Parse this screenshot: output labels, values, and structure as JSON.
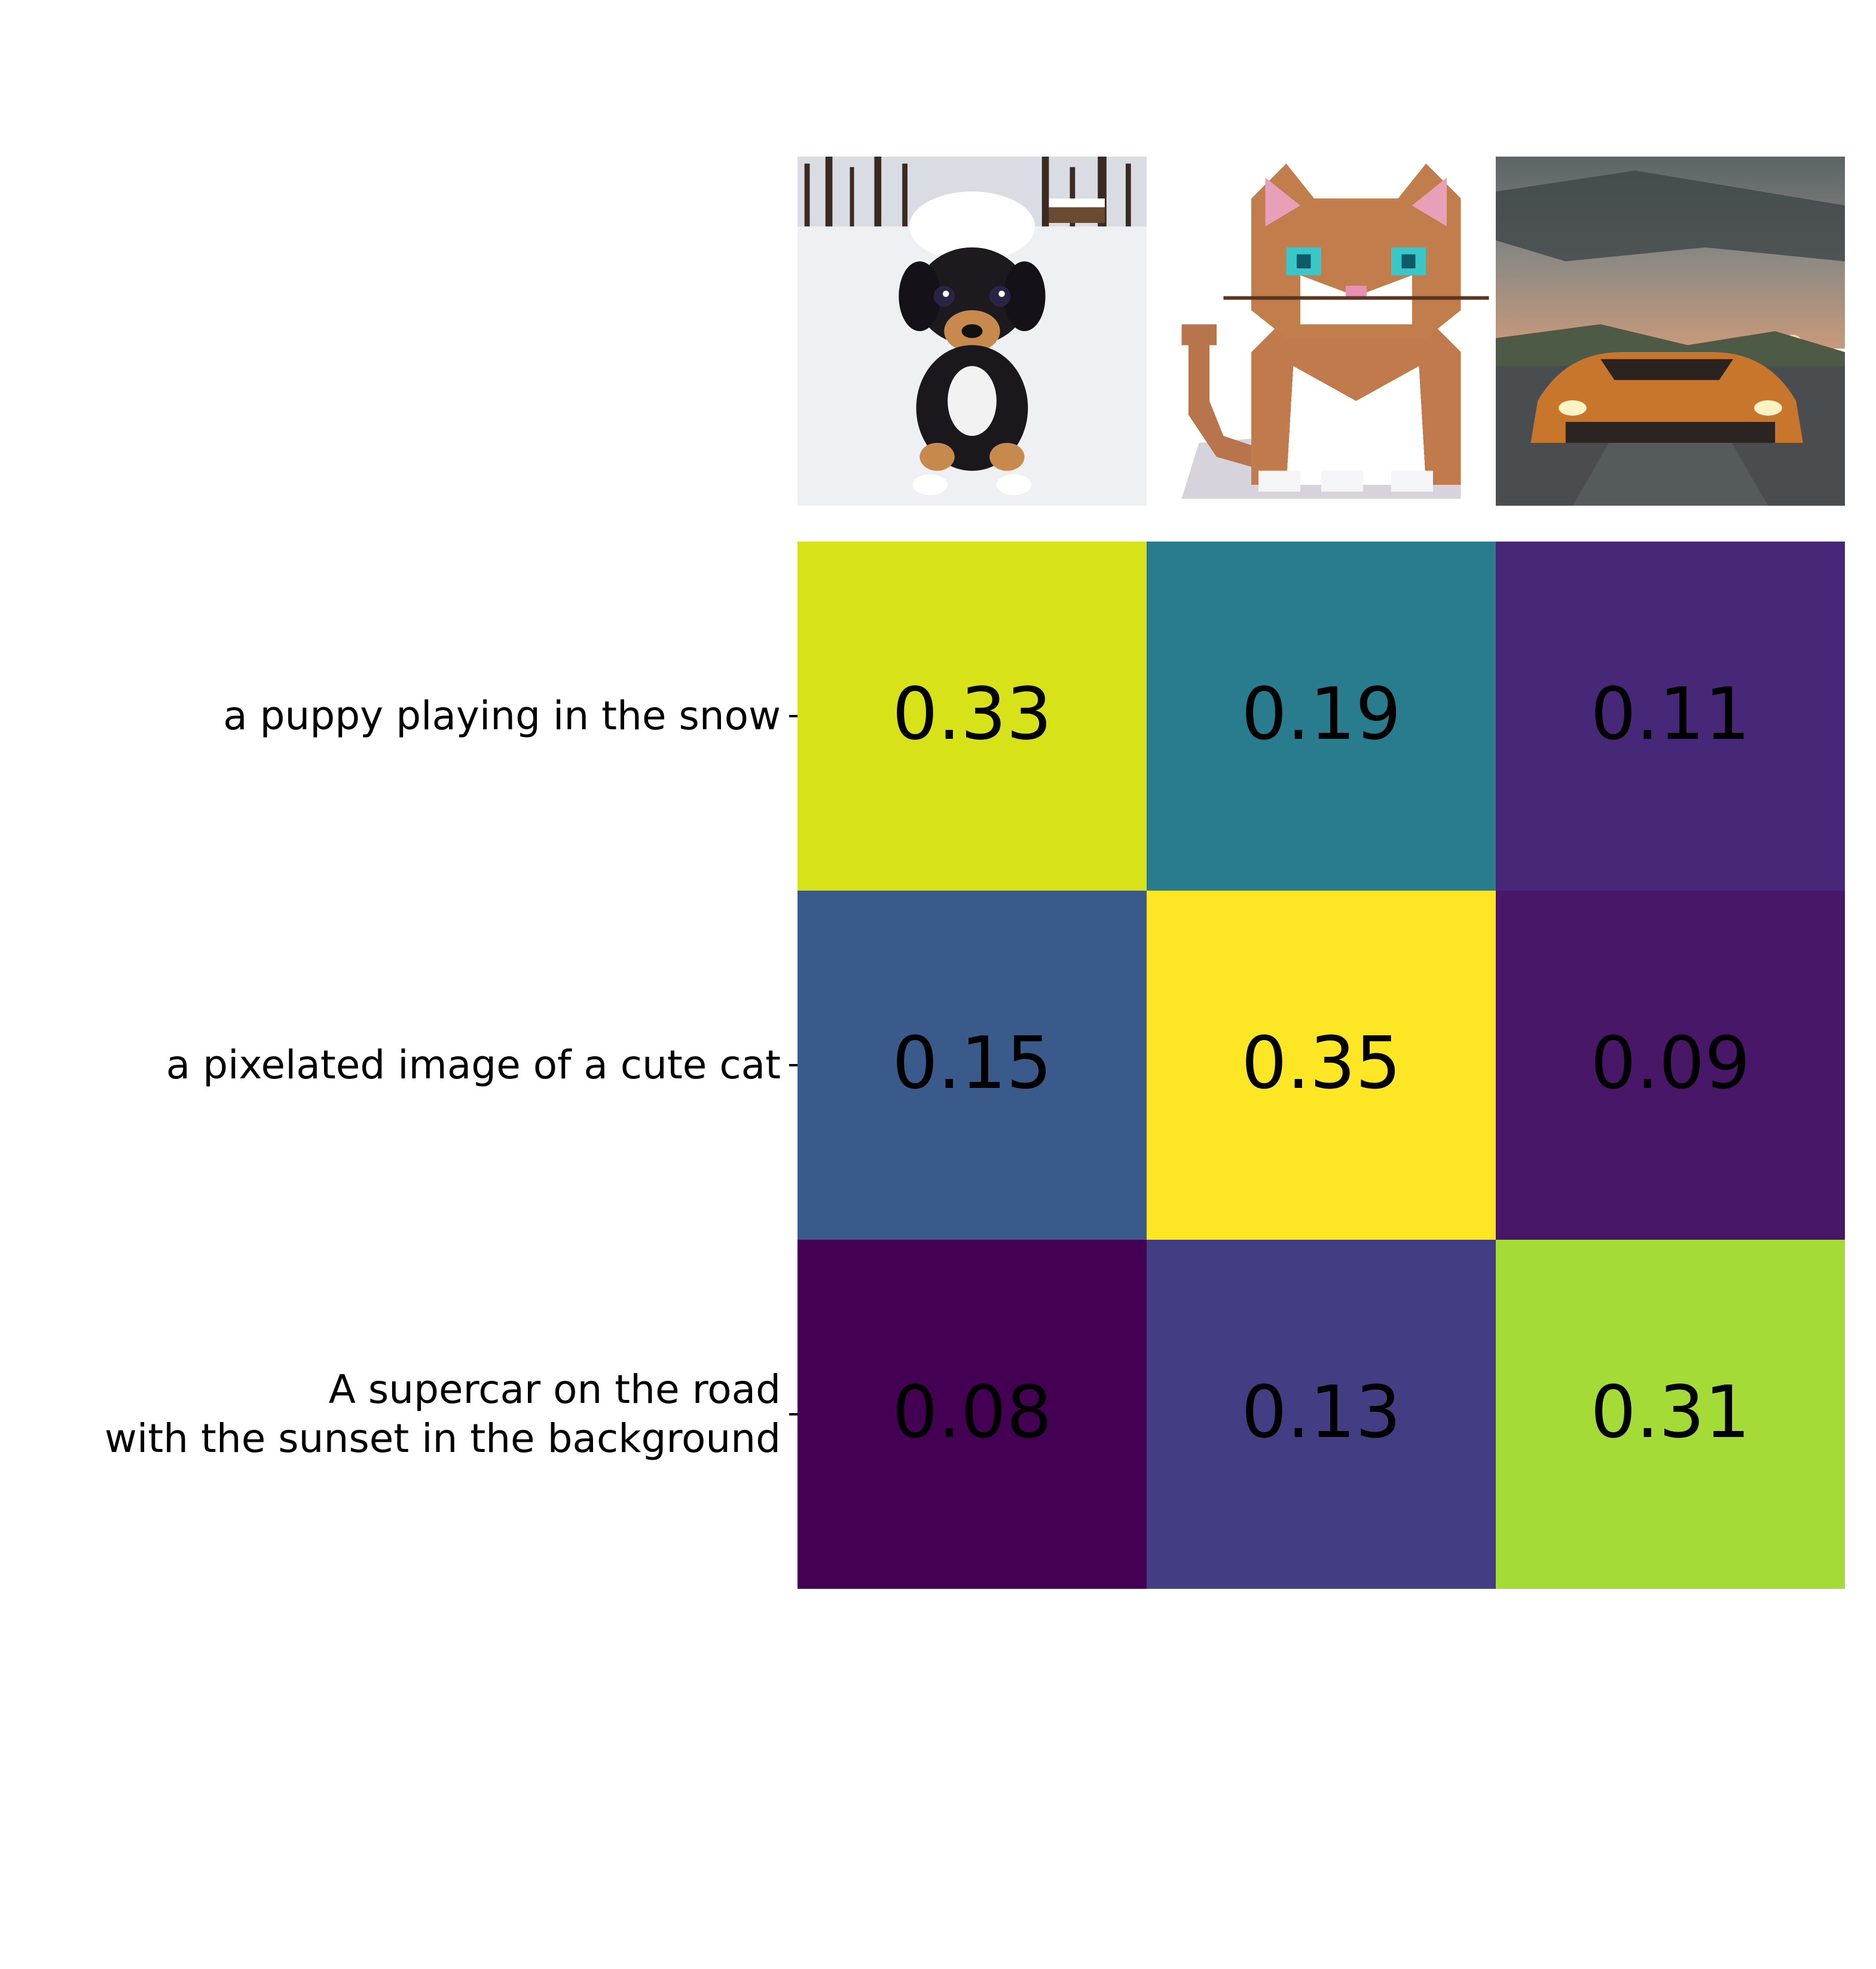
{
  "chart_data": {
    "type": "heatmap",
    "title": "",
    "colormap": "viridis",
    "x_labels_images": [
      "puppy-in-snow-image",
      "pixel-cat-image",
      "supercar-sunset-image"
    ],
    "y_labels": [
      "a puppy playing in the snow",
      "a pixelated image of a cute cat",
      "A supercar on the road\nwith the sunset in the background"
    ],
    "values": [
      [
        0.33,
        0.19,
        0.11
      ],
      [
        0.15,
        0.35,
        0.09
      ],
      [
        0.08,
        0.13,
        0.31
      ]
    ],
    "cell_labels": [
      [
        "0.33",
        "0.19",
        "0.11"
      ],
      [
        "0.15",
        "0.35",
        "0.09"
      ],
      [
        "0.08",
        "0.13",
        "0.31"
      ]
    ],
    "colors": [
      [
        "#d8e219",
        "#287c8e",
        "#472878"
      ],
      [
        "#3b5a8c",
        "#fde725",
        "#481768"
      ],
      [
        "#440154",
        "#433d84",
        "#a5db36"
      ]
    ]
  }
}
